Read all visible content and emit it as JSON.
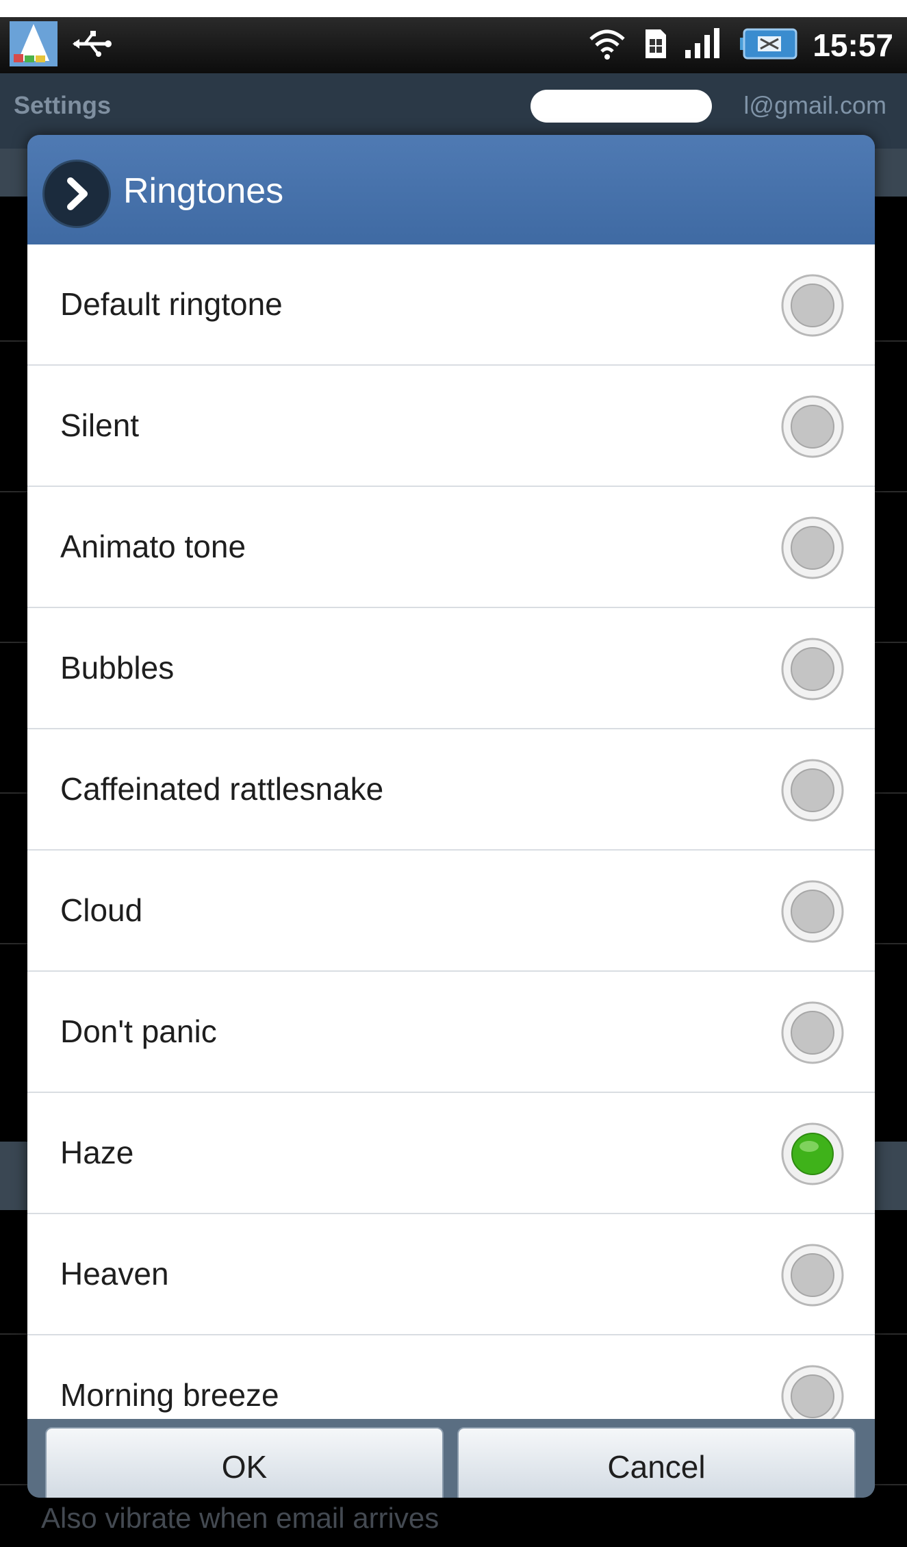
{
  "status_bar": {
    "time": "15:57",
    "icons": [
      "app-launcher-icon",
      "usb-icon",
      "wifi-icon",
      "sim-icon",
      "signal-icon",
      "battery-icon"
    ]
  },
  "background": {
    "title": "Settings",
    "account": "l@gmail.com",
    "footer_text": "Also vibrate when email arrives"
  },
  "dialog": {
    "title": "Ringtones",
    "options": [
      {
        "label": "Default ringtone",
        "selected": false
      },
      {
        "label": "Silent",
        "selected": false
      },
      {
        "label": "Animato tone",
        "selected": false
      },
      {
        "label": "Bubbles",
        "selected": false
      },
      {
        "label": "Caffeinated rattlesnake",
        "selected": false
      },
      {
        "label": "Cloud",
        "selected": false
      },
      {
        "label": "Don't panic",
        "selected": false
      },
      {
        "label": "Haze",
        "selected": true
      },
      {
        "label": "Heaven",
        "selected": false
      },
      {
        "label": "Morning breeze",
        "selected": false
      }
    ],
    "ok_label": "OK",
    "cancel_label": "Cancel"
  },
  "colors": {
    "header": "#4a74ad",
    "selected_radio": "#3fb21a",
    "status_bar": "#111111"
  }
}
